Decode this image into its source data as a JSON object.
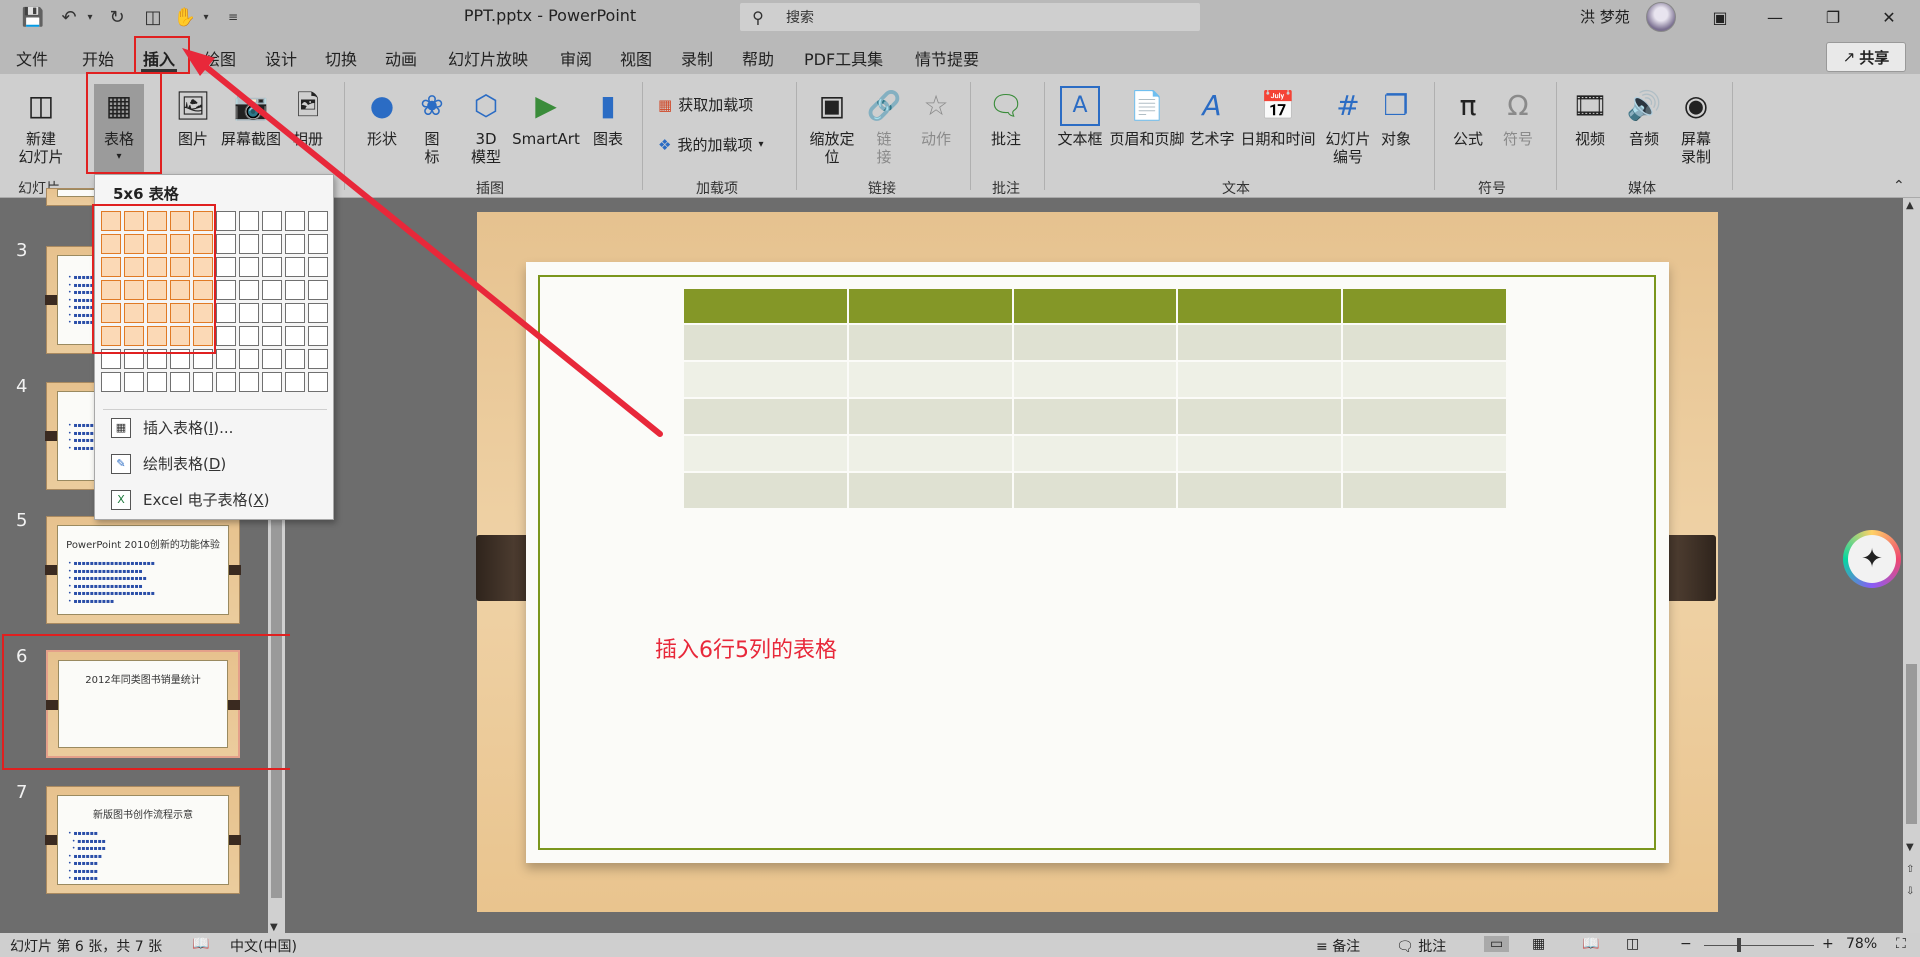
{
  "titlebar": {
    "doc_title": "PPT.pptx  -  PowerPoint",
    "search_placeholder": "搜索",
    "user_name": "洪 梦苑"
  },
  "menu": {
    "tabs": [
      "文件",
      "开始",
      "插入",
      "绘图",
      "设计",
      "切换",
      "动画",
      "幻灯片放映",
      "审阅",
      "视图",
      "录制",
      "帮助",
      "PDF工具集",
      "情节提要"
    ],
    "active": "插入",
    "share_label": "共享"
  },
  "ribbon": {
    "new_slide": "新建\n幻灯片",
    "table": "表格",
    "pictures": "图片",
    "screenshot": "屏幕截图",
    "album": "相册",
    "shapes": "形状",
    "icons": "图\n标",
    "model3d": "3D\n模型",
    "smartart": "SmartArt",
    "chart": "图表",
    "get_addins": "获取加载项",
    "my_addins": "我的加载项",
    "zoom": "缩放定\n位",
    "link": "链\n接",
    "action": "动作",
    "comment": "批注",
    "textbox": "文本框",
    "header_footer": "页眉和页脚",
    "wordart": "艺术字",
    "datetime": "日期和时间",
    "slide_number": "幻灯片\n编号",
    "object": "对象",
    "equation": "公式",
    "symbol": "符号",
    "video": "视频",
    "audio": "音频",
    "screen_record": "屏幕\n录制",
    "groups": {
      "slides": "幻灯片",
      "illustrations": "插图",
      "addins": "加载项",
      "links": "链接",
      "comments": "批注",
      "text": "文本",
      "symbols": "符号",
      "media": "媒体"
    }
  },
  "table_menu": {
    "header": "5x6 表格",
    "items": [
      {
        "label": "插入表格(",
        "key": "I",
        "suffix": ")..."
      },
      {
        "label": "绘制表格(",
        "key": "D",
        "suffix": ")"
      },
      {
        "label": "Excel 电子表格(",
        "key": "X",
        "suffix": ")"
      }
    ],
    "grid_cols": 10,
    "grid_rows": 8,
    "selected_cols": 5,
    "selected_rows": 6
  },
  "thumbnails": [
    {
      "num": "3",
      "title": ""
    },
    {
      "num": "4",
      "title": ""
    },
    {
      "num": "5",
      "title": "PowerPoint 2010创新的功能体验"
    },
    {
      "num": "6",
      "title": "2012年同类图书销量统计"
    },
    {
      "num": "7",
      "title": "新版图书创作流程示意"
    }
  ],
  "slide": {
    "annotation": "插入6行5列的表格",
    "table_rows": 6,
    "table_cols": 5,
    "colors": {
      "header": "#849727",
      "row_a": "#dfe1d2",
      "row_b": "#eef0e6",
      "frame": "#7b961d"
    }
  },
  "statusbar": {
    "slide_info": "幻灯片 第 6 张，共 7 张",
    "language": "中文(中国)",
    "notes": "备注",
    "comments": "批注",
    "zoom": "78%"
  },
  "annotation_color": "#e02020"
}
